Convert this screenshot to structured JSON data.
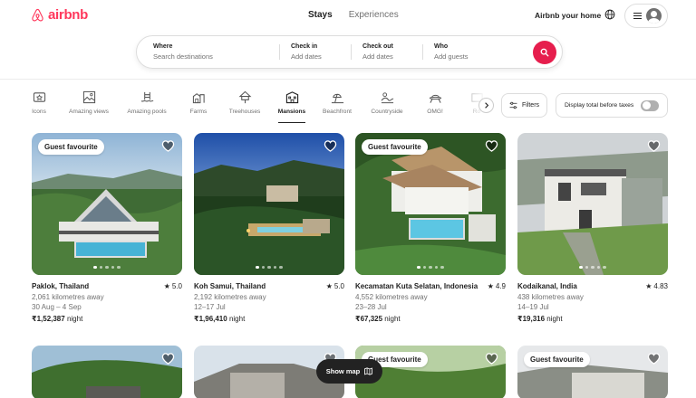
{
  "brand": {
    "name": "airbnb",
    "color": "#ff385c"
  },
  "nav": {
    "tabs": [
      "Stays",
      "Experiences"
    ],
    "active": "Stays",
    "host_link": "Airbnb your home"
  },
  "search": {
    "where_label": "Where",
    "where_placeholder": "Search destinations",
    "checkin_label": "Check in",
    "checkin_value": "Add dates",
    "checkout_label": "Check out",
    "checkout_value": "Add dates",
    "who_label": "Who",
    "who_value": "Add guests",
    "button_color": "#e61e4d"
  },
  "categories": [
    {
      "label": "Icons",
      "icon": "icons-icon"
    },
    {
      "label": "Amazing views",
      "icon": "views-icon"
    },
    {
      "label": "Amazing pools",
      "icon": "pool-icon"
    },
    {
      "label": "Farms",
      "icon": "farm-icon"
    },
    {
      "label": "Treehouses",
      "icon": "treehouse-icon"
    },
    {
      "label": "Mansions",
      "icon": "mansion-icon",
      "active": true
    },
    {
      "label": "Beachfront",
      "icon": "beach-icon"
    },
    {
      "label": "Countryside",
      "icon": "countryside-icon"
    },
    {
      "label": "OMG!",
      "icon": "ufo-icon"
    },
    {
      "label": "Ro",
      "icon": "room-icon"
    }
  ],
  "filters_label": "Filters",
  "tax_toggle_label": "Display total before taxes",
  "listings": [
    {
      "badge": "Guest favourite",
      "location": "Paklok, Thailand",
      "rating": "5.0",
      "distance": "2,061 kilometres away",
      "dates": "30 Aug – 4 Sep",
      "price": "₹1,52,387",
      "price_unit": "night"
    },
    {
      "badge": "",
      "location": "Koh Samui, Thailand",
      "rating": "5.0",
      "distance": "2,192 kilometres away",
      "dates": "12–17 Jul",
      "price": "₹1,96,410",
      "price_unit": "night"
    },
    {
      "badge": "Guest favourite",
      "location": "Kecamatan Kuta Selatan, Indonesia",
      "rating": "4.9",
      "distance": "4,552 kilometres away",
      "dates": "23–28 Jul",
      "price": "₹67,325",
      "price_unit": "night"
    },
    {
      "badge": "",
      "location": "Kodaikanal, India",
      "rating": "4.83",
      "distance": "438 kilometres away",
      "dates": "14–19 Jul",
      "price": "₹19,316",
      "price_unit": "night"
    }
  ],
  "listings_row2": [
    {
      "badge": ""
    },
    {
      "badge": ""
    },
    {
      "badge": "Guest favourite"
    },
    {
      "badge": "Guest favourite"
    }
  ],
  "show_map_label": "Show map"
}
